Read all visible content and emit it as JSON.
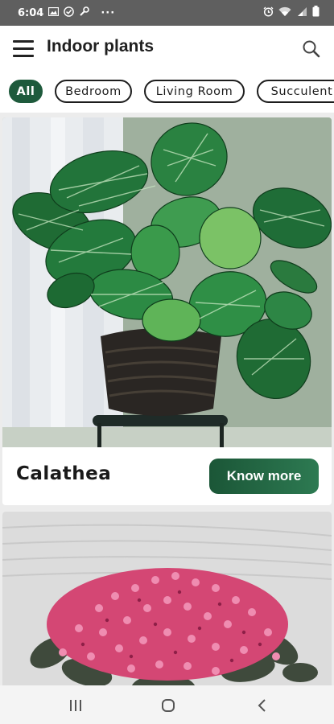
{
  "status_bar": {
    "time": "6:04",
    "more": "···",
    "icons_left": [
      "image-icon",
      "check-circle-icon",
      "wrench-icon"
    ],
    "icons_right": [
      "alarm-icon",
      "wifi-icon",
      "signal-icon",
      "battery-icon"
    ]
  },
  "app_bar": {
    "title": "Indoor plants",
    "icons": [
      "hamburger-menu-icon",
      "search-icon"
    ]
  },
  "filters": {
    "chips": [
      {
        "label": "All",
        "selected": true
      },
      {
        "label": "Bedroom",
        "selected": false
      },
      {
        "label": "Living Room",
        "selected": false
      },
      {
        "label": "Succulent",
        "selected": false
      }
    ]
  },
  "plants": [
    {
      "name": "Calathea",
      "button_label": "Know more"
    },
    {
      "name": "",
      "button_label": ""
    }
  ],
  "colors": {
    "accent": "#1e5a3c",
    "status_bar": "#5f5f5f",
    "page_background": "#ececec"
  },
  "nav_bar": {
    "icons": [
      "recent-apps-icon",
      "home-icon",
      "back-icon"
    ]
  }
}
